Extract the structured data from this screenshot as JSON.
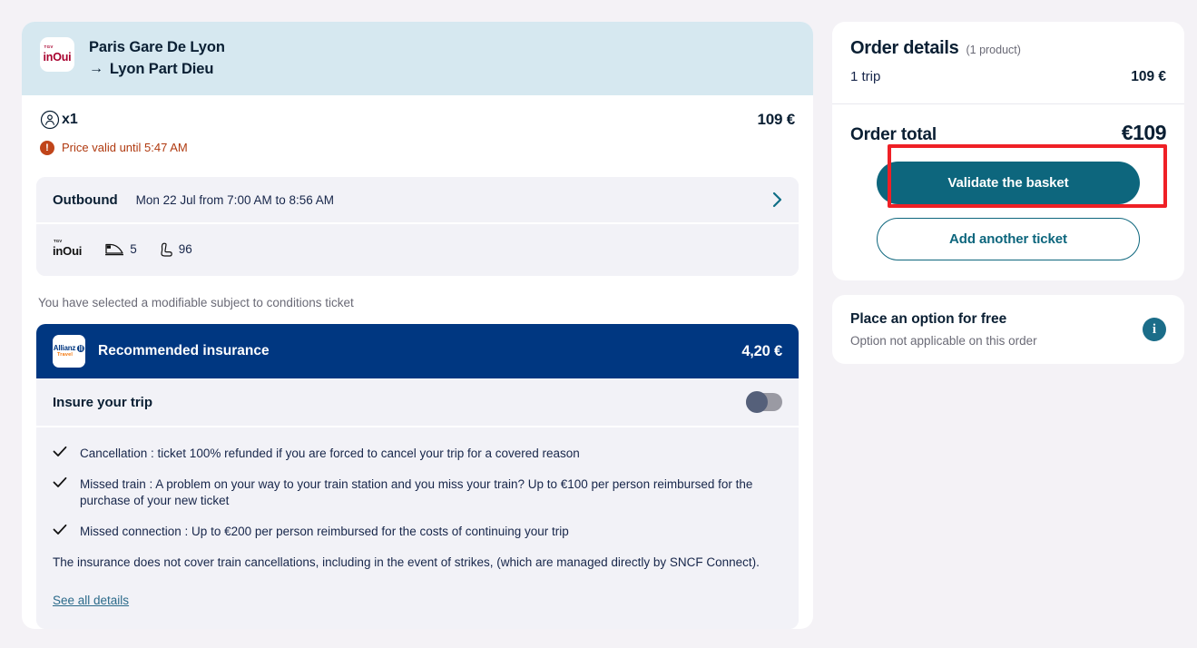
{
  "trip": {
    "brand": "inOui",
    "brand_sup": "TGV",
    "origin": "Paris Gare De Lyon",
    "arrow": "→",
    "destination": "Lyon Part Dieu",
    "passenger_count": "x1",
    "passenger_icon": "person-icon",
    "price": "109 €",
    "warning_icon": "alert-circle-icon",
    "warning_text": "Price valid until 5:47 AM",
    "leg": {
      "title": "Outbound",
      "schedule": "Mon 22 Jul from 7:00 AM to 8:56 AM",
      "chevron_icon": "chevron-right-icon",
      "train_icon": "train-nose-icon",
      "train_number": "5",
      "seat_icon": "seat-icon",
      "seat_number": "96"
    },
    "ticket_note": "You have selected a modifiable subject to conditions ticket"
  },
  "insurance": {
    "partner": "Allianz",
    "partner_sub": "Travel",
    "title": "Recommended insurance",
    "price": "4,20 €",
    "toggle_label": "Insure your trip",
    "toggle_state": "off",
    "benefits": [
      "Cancellation : ticket 100% refunded if you are forced to cancel your trip for a covered reason",
      "Missed train : A problem on your way to your train station and you miss your train? Up to €100 per person reimbursed for the purchase of your new ticket",
      "Missed connection : Up to €200 per person reimbursed for the costs of continuing your trip"
    ],
    "disclaimer": "The insurance does not cover train cancellations, including in the event of strikes, (which are managed directly by SNCF Connect).",
    "see_all_label": "See all details"
  },
  "order": {
    "details_title": "Order details",
    "details_subtitle": "(1 product)",
    "line_label": "1 trip",
    "line_amount": "109 €",
    "total_label": "Order total",
    "total_amount": "€109",
    "primary_button": "Validate the basket",
    "secondary_button": "Add another ticket"
  },
  "option": {
    "title": "Place an option for free",
    "subtitle": "Option not applicable on this order",
    "info_icon": "info-icon",
    "info_glyph": "i"
  },
  "colors": {
    "page_bg": "#f4f2f6",
    "header_bg": "#d6e8f0",
    "teal": "#0d667d",
    "allianz_blue": "#003781",
    "warning": "#b03a10",
    "highlight": "#ef2026",
    "brand_red": "#a8002e"
  }
}
